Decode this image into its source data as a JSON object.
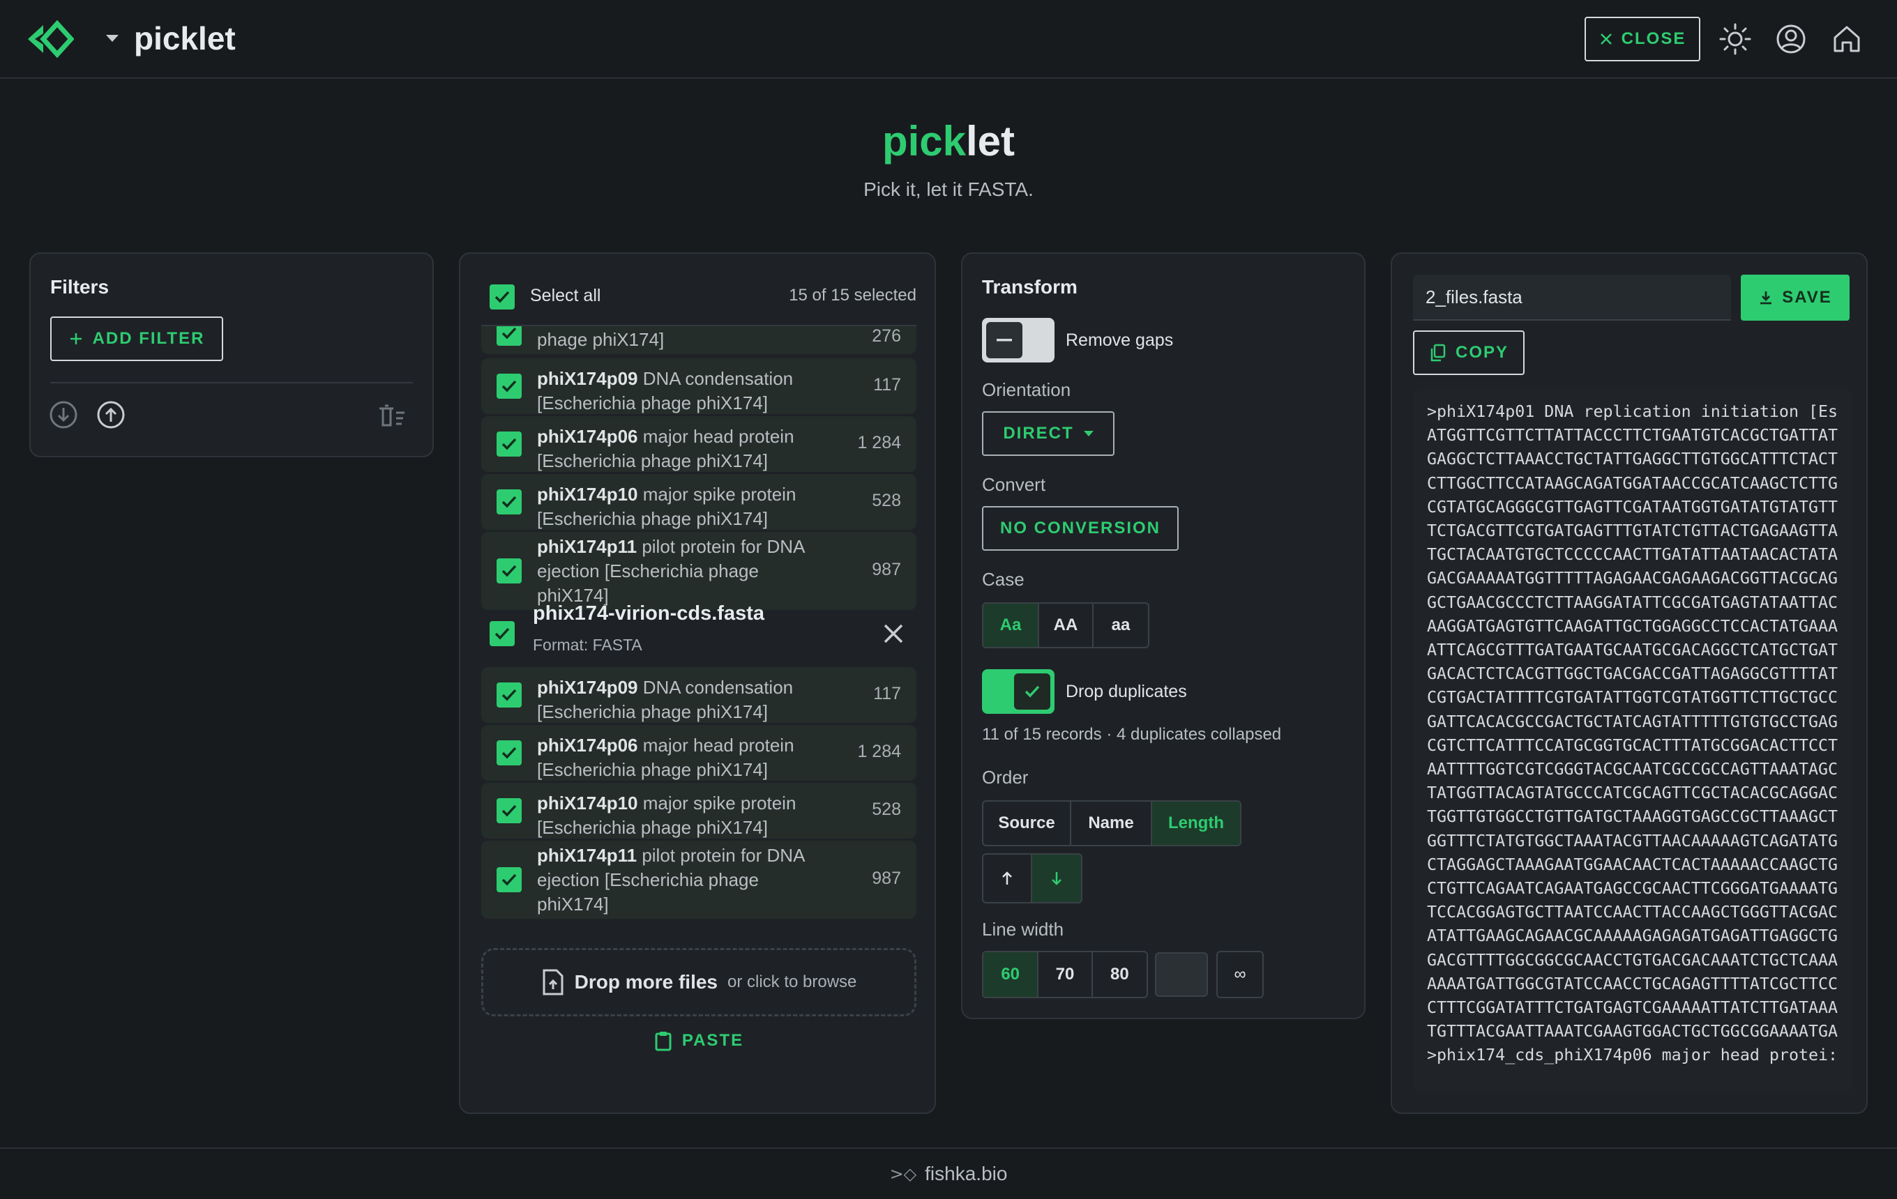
{
  "header": {
    "app_name": "picklet",
    "close_label": "CLOSE",
    "icons": [
      "picklet-logo-icon",
      "theme-sun-icon",
      "account-icon",
      "home-icon"
    ]
  },
  "hero": {
    "title_accent": "pick",
    "title_rest": "let",
    "subtitle": "Pick it, let it FASTA."
  },
  "filters": {
    "title": "Filters",
    "add_filter_label": "ADD FILTER"
  },
  "records": {
    "select_all_label": "Select all",
    "selected_count": "15 of 15 selected",
    "partial_top": {
      "text": "phage phiX174]",
      "length": "276"
    },
    "group1": [
      {
        "id": "phiX174p09",
        "desc": "DNA condensation",
        "desc2": "[Escherichia phage phiX174]",
        "length": "117"
      },
      {
        "id": "phiX174p06",
        "desc": "major head protein",
        "desc2": "[Escherichia phage phiX174]",
        "length": "1 284"
      },
      {
        "id": "phiX174p10",
        "desc": "major spike protein",
        "desc2": "[Escherichia phage phiX174]",
        "length": "528"
      },
      {
        "id": "phiX174p11",
        "desc": "pilot protein for DNA",
        "desc2": "ejection [Escherichia phage",
        "desc3": "phiX174]",
        "length": "987"
      }
    ],
    "file2": {
      "name": "phix174-virion-cds.fasta",
      "format": "Format: FASTA"
    },
    "group2": [
      {
        "id": "phiX174p09",
        "desc": "DNA condensation",
        "desc2": "[Escherichia phage phiX174]",
        "length": "117"
      },
      {
        "id": "phiX174p06",
        "desc": "major head protein",
        "desc2": "[Escherichia phage phiX174]",
        "length": "1 284"
      },
      {
        "id": "phiX174p10",
        "desc": "major spike protein",
        "desc2": "[Escherichia phage phiX174]",
        "length": "528"
      },
      {
        "id": "phiX174p11",
        "desc": "pilot protein for DNA",
        "desc2": "ejection [Escherichia phage",
        "desc3": "phiX174]",
        "length": "987"
      }
    ],
    "drop_label": "Drop more files",
    "drop_hint": "or click to browse",
    "paste_label": "PASTE"
  },
  "transform": {
    "title": "Transform",
    "remove_gaps_label": "Remove gaps",
    "orientation_label": "Orientation",
    "orientation_value": "DIRECT",
    "convert_label": "Convert",
    "convert_value": "NO CONVERSION",
    "case_label": "Case",
    "case_options": [
      "Aa",
      "AA",
      "aa"
    ],
    "case_selected": "Aa",
    "drop_duplicates_label": "Drop duplicates",
    "dup_summary": "11 of 15 records · 4 duplicates collapsed",
    "order_label": "Order",
    "order_options": [
      "Source",
      "Name",
      "Length"
    ],
    "order_selected": "Length",
    "direction_selected": "descending",
    "line_width_label": "Line width",
    "line_width_options": [
      "60",
      "70",
      "80",
      "",
      "∞"
    ],
    "line_width_selected": "60"
  },
  "output": {
    "filename": "2_files.fasta",
    "save_label": "SAVE",
    "copy_label": "COPY",
    "lines": [
      ">phiX174p01 DNA replication initiation [Es",
      "ATGGTTCGTTCTTATTACCCTTCTGAATGTCACGCTGATTAT",
      "GAGGCTCTTAAACCTGCTATTGAGGCTTGTGGCATTTCTACT",
      "CTTGGCTTCCATAAGCAGATGGATAACCGCATCAAGCTCTTG",
      "CGTATGCAGGGCGTTGAGTTCGATAATGGTGATATGTATGTT",
      "TCTGACGTTCGTGATGAGTTTGTATCTGTTACTGAGAAGTTA",
      "TGCTACAATGTGCTCCCCCAACTTGATATTAATAACACTATA",
      "GACGAAAAATGGTTTTTAGAGAACGAGAAGACGGTTACGCAG",
      "GCTGAACGCCCTCTTAAGGATATTCGCGATGAGTATAATTAC",
      "AAGGATGAGTGTTCAAGATTGCTGGAGGCCTCCACTATGAAA",
      "ATTCAGCGTTTGATGAATGCAATGCGACAGGCTCATGCTGAT",
      "GACACTCTCACGTTGGCTGACGACCGATTAGAGGCGTTTTAT",
      "CGTGACTATTTTCGTGATATTGGTCGTATGGTTCTTGCTGCC",
      "GATTCACACGCCGACTGCTATCAGTATTTTTGTGTGCCTGAG",
      "CGTCTTCATTTCCATGCGGTGCACTTTATGCGGACACTTCCT",
      "AATTTTGGTCGTCGGGTACGCAATCGCCGCCAGTTAAATAGC",
      "TATGGTTACAGTATGCCCATCGCAGTTCGCTACACGCAGGAC",
      "TGGTTGTGGCCTGTTGATGCTAAAGGTGAGCCGCTTAAAGCT",
      "GGTTTCTATGTGGCTAAATACGTTAACAAAAAGTCAGATATG",
      "CTAGGAGCTAAAGAATGGAACAACTCACTAAAAACCAAGCTG",
      "CTGTTCAGAATCAGAATGAGCCGCAACTTCGGGATGAAAATG",
      "TCCACGGAGTGCTTAATCCAACTTACCAAGCTGGGTTACGAC",
      "ATATTGAAGCAGAACGCAAAAAGAGAGATGAGATTGAGGCTG",
      "GACGTTTTGGCGGCGCAACCTGTGACGACAAATCTGCTCAAA",
      "AAAATGATTGGCGTATCCAACCTGCAGAGTTTTATCGCTTCC",
      "CTTTCGGATATTTCTGATGAGTCGAAAAATTATCTTGATAAA",
      "TGTTTACGAATTAAATCGAAGTGGACTGCTGGCGGAAAATGA",
      ">phix174_cds_phiX174p06 major head protei:"
    ]
  },
  "footer": {
    "mark": ">◇",
    "text": "fishka.bio"
  },
  "colors": {
    "accent": "#2ecc71",
    "background": "#181b1e",
    "panel": "#1e2226"
  }
}
